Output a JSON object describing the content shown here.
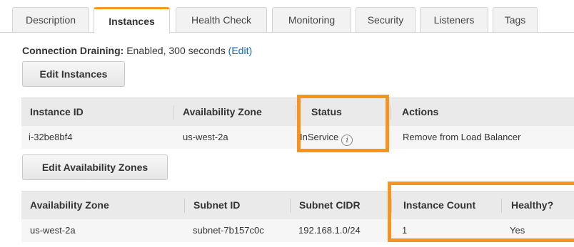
{
  "tabs": [
    {
      "label": "Description"
    },
    {
      "label": "Instances",
      "active": true
    },
    {
      "label": "Health Check"
    },
    {
      "label": "Monitoring"
    },
    {
      "label": "Security"
    },
    {
      "label": "Listeners"
    },
    {
      "label": "Tags"
    }
  ],
  "connection_draining": {
    "label": "Connection Draining:",
    "value": "Enabled, 300 seconds",
    "edit_link": "(Edit)"
  },
  "buttons": {
    "edit_instances": "Edit Instances",
    "edit_azs": "Edit Availability Zones"
  },
  "instances_table": {
    "headers": [
      "Instance ID",
      "Availability Zone",
      "Status",
      "Actions"
    ],
    "rows": [
      {
        "instance_id": "i-32be8bf4",
        "availability_zone": "us-west-2a",
        "status": "InService",
        "status_icon": "info-icon",
        "action": "Remove from Load Balancer"
      }
    ]
  },
  "az_table": {
    "headers": [
      "Availability Zone",
      "Subnet ID",
      "Subnet CIDR",
      "Instance Count",
      "Healthy?"
    ],
    "rows": [
      {
        "availability_zone": "us-west-2a",
        "subnet_id": "subnet-7b157c0c",
        "subnet_cidr": "192.168.1.0/24",
        "instance_count": "1",
        "healthy": "Yes"
      }
    ]
  },
  "colors": {
    "accent_orange": "#f7931e",
    "link_blue": "#1166bb",
    "header_gray": "#eaeaea"
  }
}
